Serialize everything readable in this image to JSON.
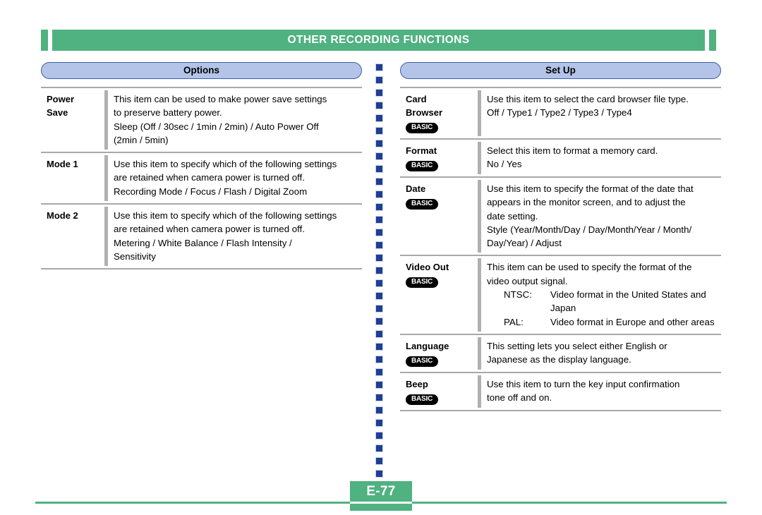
{
  "header": {
    "title": "OTHER RECORDING FUNCTIONS"
  },
  "footer": {
    "page_label": "E-77"
  },
  "colors": {
    "green": "#4fb280",
    "pill_fill": "#b3c4e8",
    "pill_border": "#3a5fab",
    "dot": "#1f3f93",
    "rule": "#a8a8a8"
  },
  "divider": {
    "dot_count": 33,
    "dot_spacing": 18
  },
  "columns": [
    {
      "id": "options",
      "title": "Options",
      "rows": [
        {
          "label": "Power\nSave",
          "basic": false,
          "description": "This item can be used to make power save settings\nto preserve battery power.\nSleep (Off / 30sec / 1min / 2min) / Auto Power Off\n(2min / 5min)"
        },
        {
          "label": "Mode 1",
          "basic": false,
          "description": "Use this item to specify which of the following settings\nare retained when camera power is turned off.\nRecording Mode / Focus / Flash / Digital Zoom"
        },
        {
          "label": "Mode 2",
          "basic": false,
          "description": "Use this item to specify which of the following settings\nare retained when camera power is turned off.\nMetering / White Balance / Flash Intensity /\nSensitivity"
        }
      ]
    },
    {
      "id": "setup",
      "title": "Set Up",
      "rows": [
        {
          "label": "Card\nBrowser",
          "basic": true,
          "basic_label": "BASIC",
          "description": "Use this item to select the card browser file type.\nOff / Type1 / Type2 / Type3 / Type4"
        },
        {
          "label": "Format",
          "basic": true,
          "basic_label": "BASIC",
          "description": "Select this item to format a memory card.\nNo / Yes"
        },
        {
          "label": "Date",
          "basic": true,
          "basic_label": "BASIC",
          "description": "Use this item to specify the format of the date that\nappears in the monitor screen, and to adjust the\ndate setting.\nStyle (Year/Month/Day / Day/Month/Year / Month/\nDay/Year) / Adjust"
        },
        {
          "label": "Video Out",
          "basic": true,
          "basic_label": "BASIC",
          "description": "This item can be used to specify the format of the\nvideo output signal.",
          "deflist": [
            {
              "term": "NTSC:",
              "desc": "Video format in the United States and\nJapan"
            },
            {
              "term": "PAL:",
              "desc": "Video format in Europe and other areas"
            }
          ]
        },
        {
          "label": "Language",
          "basic": true,
          "basic_label": "BASIC",
          "description": "This setting lets you select either English or\nJapanese as the display language."
        },
        {
          "label": "Beep",
          "basic": true,
          "basic_label": "BASIC",
          "description": "Use this item to turn the key input confirmation\ntone off and on."
        }
      ]
    }
  ]
}
